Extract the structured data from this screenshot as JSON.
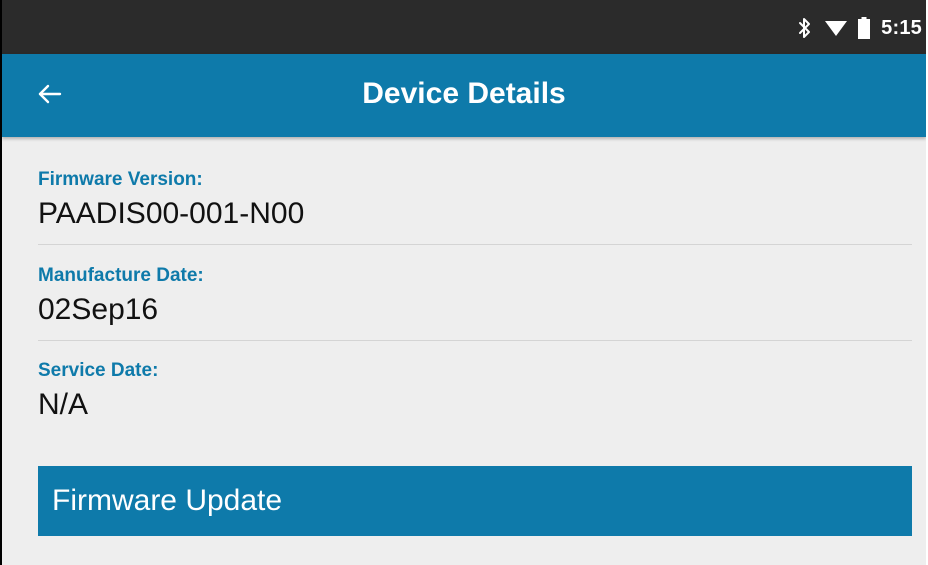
{
  "status_bar": {
    "time": "5:15",
    "icons": [
      "bluetooth-icon",
      "wifi-icon",
      "battery-icon"
    ]
  },
  "app_bar": {
    "title": "Device Details",
    "back_icon": "arrow-left-icon"
  },
  "fields": [
    {
      "label": "Firmware Version:",
      "value": "PAADIS00-001-N00"
    },
    {
      "label": "Manufacture Date:",
      "value": "02Sep16"
    },
    {
      "label": "Service Date:",
      "value": "N/A"
    }
  ],
  "actions": {
    "firmware_update_label": "Firmware Update"
  },
  "colors": {
    "accent": "#0e7aaa",
    "status_bar": "#2b2b2b",
    "background": "#eeeeee"
  }
}
